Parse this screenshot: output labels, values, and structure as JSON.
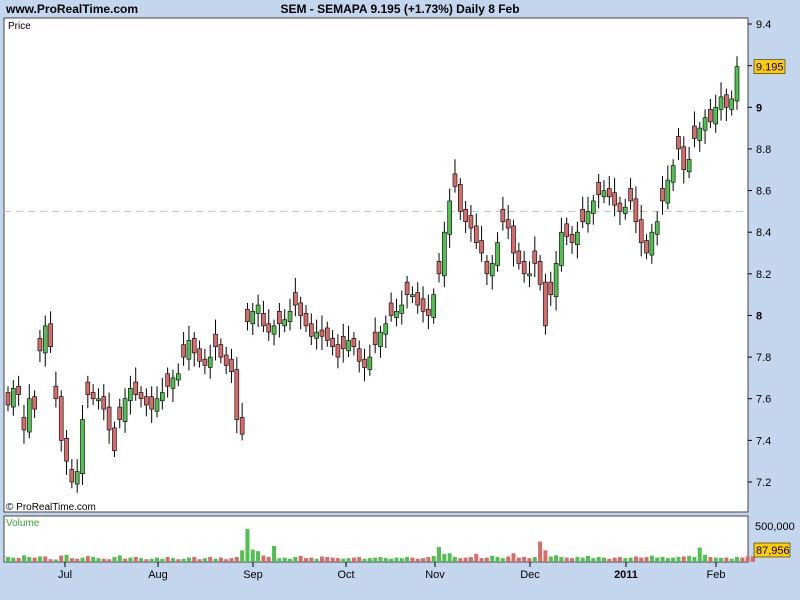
{
  "header": {
    "site": "www.ProRealTime.com",
    "title": "SEM - SEMAPA    9.195 (+1.73%)    Daily  8 Feb"
  },
  "copyright": "© ProRealTime.com",
  "price_label": "Price",
  "volume_label": "Volume",
  "last_price_badge": "9.195",
  "last_volume_badge": "87,956",
  "volume_scale_label": "500,000",
  "colors": {
    "up": "#50c050",
    "down": "#d96a6a",
    "badge": "#ffcc00",
    "panel_bg": "#ffffff",
    "frame_bg": "#c4d6ee",
    "reference_line": "#c0c0c0"
  },
  "chart_data": [
    {
      "type": "candlestick",
      "title": "SEM - SEMAPA",
      "ylabel": "Price",
      "ylim": [
        7.1,
        9.4
      ],
      "yticks": [
        7.2,
        7.4,
        7.6,
        7.8,
        8,
        8.2,
        8.4,
        8.6,
        8.8,
        9,
        9.2,
        9.4
      ],
      "ytick_labels": [
        "7.2",
        "7.4",
        "7.6",
        "7.8",
        "8",
        "8.2",
        "8.4",
        "8.6",
        "8.8",
        "9",
        "9.2",
        "9.4"
      ],
      "reference_line": 8.5,
      "last_value": 9.195,
      "x_ticks": [
        "Jul",
        "Aug",
        "Sep",
        "Oct",
        "Nov",
        "Dec",
        "2011",
        "Feb"
      ],
      "closes": [
        7.57,
        7.65,
        7.62,
        7.45,
        7.6,
        7.55,
        7.83,
        7.95,
        7.85,
        7.6,
        7.4,
        7.3,
        7.2,
        7.25,
        7.5,
        7.62,
        7.6,
        7.6,
        7.55,
        7.45,
        7.35,
        7.5,
        7.6,
        7.65,
        7.62,
        7.6,
        7.57,
        7.55,
        7.6,
        7.63,
        7.66,
        7.7,
        7.72,
        7.8,
        7.88,
        7.82,
        7.78,
        7.76,
        7.8,
        7.85,
        7.8,
        7.76,
        7.73,
        7.5,
        7.43,
        7.97,
        8.02,
        8.05,
        7.95,
        7.92,
        7.95,
        7.96,
        7.98,
        8.02,
        8.05,
        8.0,
        7.95,
        7.9,
        7.92,
        7.9,
        7.88,
        7.85,
        7.8,
        7.84,
        7.88,
        7.85,
        7.78,
        7.75,
        7.8,
        7.86,
        7.92,
        7.96,
        8.0,
        8.02,
        8.05,
        8.1,
        8.1,
        8.05,
        8.02,
        8.0,
        8.1,
        8.2,
        8.4,
        8.55,
        8.62,
        8.5,
        8.45,
        8.42,
        8.35,
        8.3,
        8.2,
        8.25,
        8.35,
        8.45,
        8.42,
        8.3,
        8.25,
        8.2,
        8.2,
        8.25,
        8.15,
        7.95,
        8.1,
        8.25,
        8.4,
        8.38,
        8.35,
        8.4,
        8.45,
        8.5,
        8.55,
        8.58,
        8.6,
        8.57,
        8.53,
        8.5,
        8.52,
        8.55,
        8.45,
        8.35,
        8.3,
        8.4,
        8.45,
        8.55,
        8.65,
        8.72,
        8.8,
        8.7,
        8.75,
        8.85,
        8.9,
        8.95,
        8.93,
        9.0,
        9.05,
        9.0,
        9.04,
        9.195
      ]
    },
    {
      "type": "bar",
      "ylabel": "Volume",
      "scale_label": "500,000",
      "last_value": 87956,
      "values": [
        62,
        55,
        50,
        83,
        62,
        55,
        70,
        70,
        35,
        31,
        80,
        90,
        48,
        41,
        55,
        73,
        65,
        48,
        41,
        35,
        62,
        83,
        41,
        55,
        62,
        48,
        35,
        41,
        55,
        41,
        62,
        48,
        35,
        41,
        55,
        62,
        35,
        48,
        62,
        41,
        55,
        35,
        48,
        62,
        145,
        415,
        155,
        135,
        80,
        62,
        200,
        48,
        55,
        41,
        62,
        76,
        48,
        55,
        41,
        69,
        62,
        55,
        48,
        41,
        48,
        55,
        62,
        41,
        48,
        55,
        62,
        48,
        41,
        55,
        48,
        62,
        55,
        41,
        48,
        62,
        76,
        186,
        100,
        110,
        62,
        48,
        55,
        62,
        100,
        48,
        55,
        76,
        62,
        48,
        69,
        110,
        55,
        62,
        48,
        62,
        255,
        145,
        69,
        83,
        62,
        55,
        48,
        62,
        55,
        76,
        48,
        62,
        55,
        41,
        55,
        62,
        48,
        55,
        69,
        55,
        62,
        80,
        55,
        62,
        48,
        55,
        62,
        69,
        76,
        62,
        180,
        90,
        62,
        55,
        50,
        55,
        41,
        62,
        55,
        69,
        70
      ],
      "up": [
        1,
        1,
        0,
        1,
        1,
        0,
        1,
        0,
        0,
        1,
        0,
        1,
        0,
        0,
        1,
        0,
        1,
        1,
        0,
        0,
        1,
        1,
        0,
        1,
        0,
        1,
        0,
        1,
        1,
        1,
        0,
        1,
        0,
        1,
        1,
        0,
        0,
        1,
        0,
        1,
        0,
        0,
        0,
        0,
        1,
        1,
        1,
        1,
        0,
        0,
        1,
        1,
        1,
        1,
        1,
        0,
        0,
        0,
        1,
        0,
        0,
        0,
        0,
        1,
        1,
        0,
        0,
        1,
        1,
        1,
        1,
        1,
        1,
        1,
        1,
        1,
        0,
        0,
        0,
        0,
        1,
        1,
        1,
        1,
        1,
        0,
        0,
        0,
        0,
        0,
        0,
        1,
        1,
        1,
        0,
        0,
        0,
        0,
        0,
        1,
        0,
        0,
        1,
        1,
        1,
        0,
        0,
        1,
        1,
        1,
        1,
        1,
        1,
        0,
        0,
        0,
        1,
        1,
        0,
        0,
        0,
        1,
        1,
        1,
        1,
        1,
        1,
        0,
        1,
        1,
        1,
        1,
        0,
        1,
        1,
        0,
        1,
        1
      ]
    }
  ]
}
